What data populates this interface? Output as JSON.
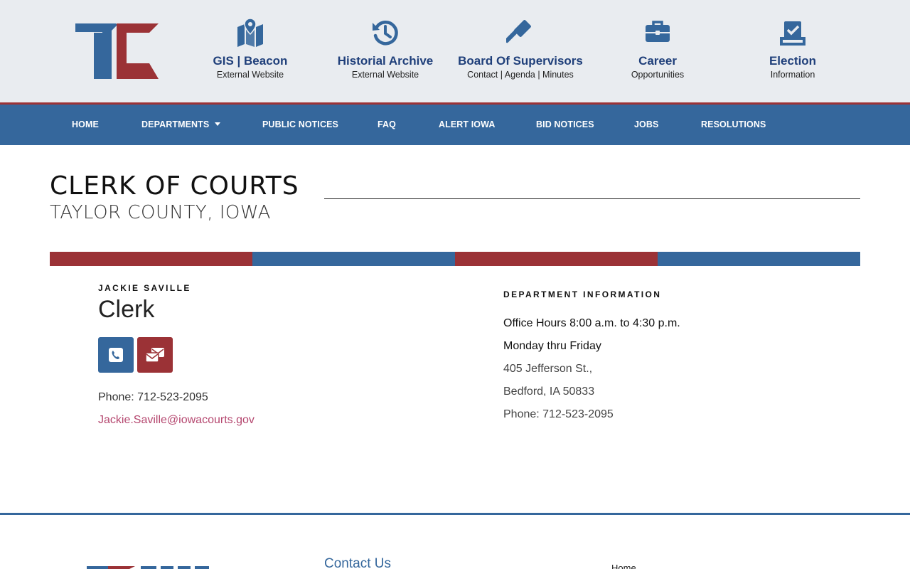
{
  "brand": {
    "colors": {
      "blue": "#35679c",
      "red": "#9b3236",
      "navy": "#1f3f7a",
      "banner_bg": "#e9ecf0"
    }
  },
  "quick_links": [
    {
      "title": "GIS | Beacon",
      "subtitle": "External Website",
      "icon": "map-marker-icon"
    },
    {
      "title": "Historial Archive",
      "subtitle": "External Website",
      "icon": "history-icon"
    },
    {
      "title": "Board Of Supervisors",
      "subtitle": "Contact | Agenda | Minutes",
      "icon": "gavel-icon"
    },
    {
      "title": "Career",
      "subtitle": "Opportunities",
      "icon": "briefcase-icon"
    },
    {
      "title": "Election",
      "subtitle": "Information",
      "icon": "ballot-check-icon"
    }
  ],
  "nav": {
    "items": [
      "HOME",
      "DEPARTMENTS",
      "PUBLIC NOTICES",
      "FAQ",
      "ALERT IOWA",
      "BID NOTICES",
      "JOBS",
      "RESOLUTIONS"
    ]
  },
  "page": {
    "title": "CLERK OF COURTS",
    "subtitle": "TAYLOR COUNTY, IOWA"
  },
  "contact": {
    "name": "JACKIE SAVILLE",
    "role": "Clerk",
    "phone": "Phone: 712-523-2095",
    "email": "Jackie.Saville@iowacourts.gov",
    "buttons": {
      "phone_icon": "phone-icon",
      "email_icon": "envelope-icon"
    }
  },
  "department": {
    "heading": "DEPARTMENT INFORMATION",
    "hours": "Office Hours 8:00 a.m. to 4:30 p.m.",
    "days": "Monday thru Friday",
    "street": "405 Jefferson St.,",
    "city": "Bedford, IA 50833",
    "phone": "Phone: 712-523-2095"
  },
  "footer": {
    "contact_heading": "Contact Us",
    "home_link": "Home"
  }
}
